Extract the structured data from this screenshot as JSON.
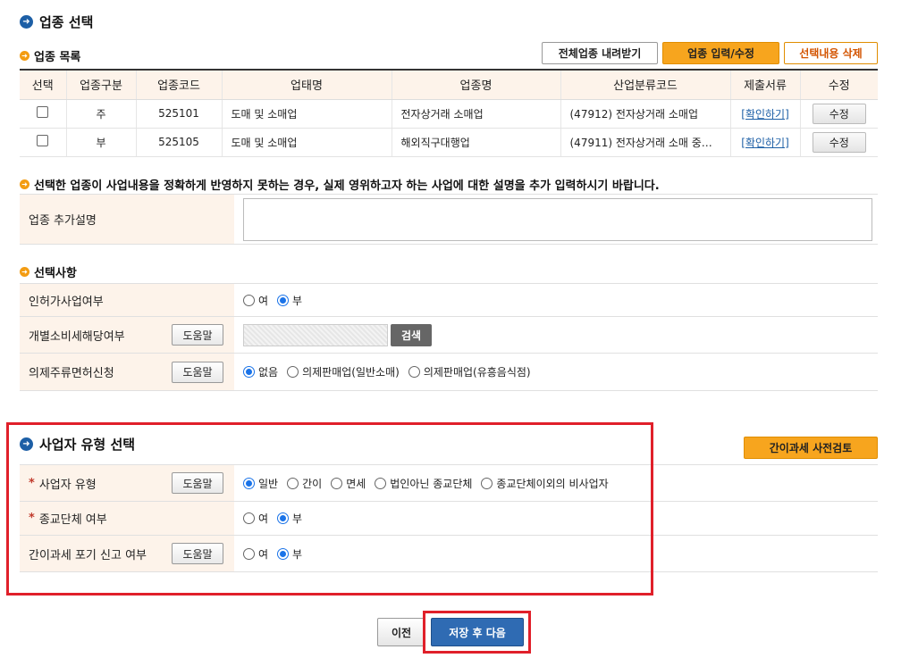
{
  "section_title": "업종 선택",
  "list_title": "업종 목록",
  "buttons": {
    "download_all": "전체업종 내려받기",
    "input_edit": "업종 입력/수정",
    "delete_selected": "선택내용 삭제",
    "simple_tax_review": "간이과세 사전검토",
    "prev": "이전",
    "save_next": "저장 후 다음",
    "search": "검색",
    "help": "도움말"
  },
  "table": {
    "headers": [
      "선택",
      "업종구분",
      "업종코드",
      "업태명",
      "업종명",
      "산업분류코드",
      "제출서류",
      "수정"
    ],
    "rows": [
      {
        "type": "주",
        "code": "525101",
        "biz": "도매 및 소매업",
        "name": "전자상거래 소매업",
        "ind": "(47912) 전자상거래 소매업",
        "doc": "[확인하기]",
        "edit": "수정"
      },
      {
        "type": "부",
        "code": "525105",
        "biz": "도매 및 소매업",
        "name": "해외직구대행업",
        "ind": "(47911) 전자상거래 소매 중…",
        "doc": "[확인하기]",
        "edit": "수정"
      }
    ]
  },
  "notice": "선택한 업종이 사업내용을 정확하게 반영하지 못하는 경우, 실제 영위하고자 하는 사업에 대한 설명을 추가 입력하시기 바랍니다.",
  "extra_desc_label": "업종 추가설명",
  "options_title": "선택사항",
  "options": {
    "license": {
      "label": "인허가사업여부",
      "opts": [
        "여",
        "부"
      ]
    },
    "consumption": {
      "label": "개별소비세해당여부"
    },
    "liquor": {
      "label": "의제주류면허신청",
      "opts": [
        "없음",
        "의제판매업(일반소매)",
        "의제판매업(유흥음식점)"
      ]
    }
  },
  "biz_type_title": "사업자 유형 선택",
  "biz_type": {
    "type": {
      "label": "사업자 유형",
      "opts": [
        "일반",
        "간이",
        "면세",
        "법인아닌 종교단체",
        "종교단체이외의 비사업자"
      ]
    },
    "religious": {
      "label": "종교단체 여부",
      "opts": [
        "여",
        "부"
      ]
    },
    "waiver": {
      "label": "간이과세 포기 신고 여부",
      "opts": [
        "여",
        "부"
      ]
    }
  }
}
